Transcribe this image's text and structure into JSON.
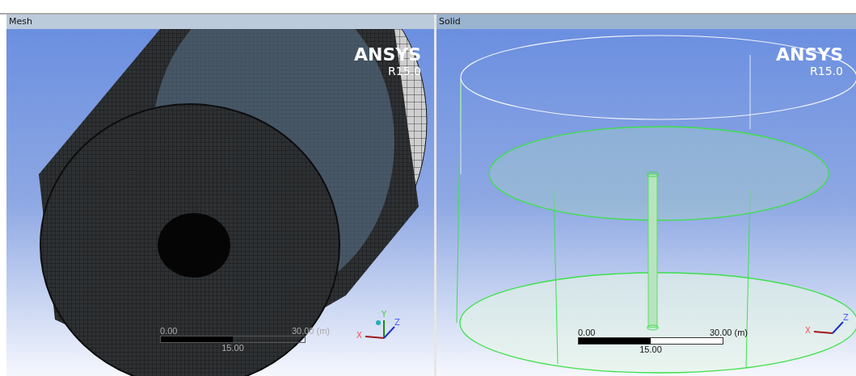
{
  "viewports": [
    {
      "title": "Mesh",
      "kind": "mesh",
      "logo": "ANSYS",
      "version": "R15.0",
      "scale": {
        "min": "0.00",
        "max": "30.00 (m)",
        "mid": "15.00"
      },
      "triad": {
        "x": "X",
        "y": "Y",
        "z": "Z"
      }
    },
    {
      "title": "Solid",
      "kind": "solid",
      "logo": "ANSYS",
      "version": "R15.0",
      "scale": {
        "min": "0.00",
        "max": "30.00 (m)",
        "mid": "15.00"
      },
      "triad": {
        "x": "X",
        "z": "Z"
      }
    }
  ]
}
